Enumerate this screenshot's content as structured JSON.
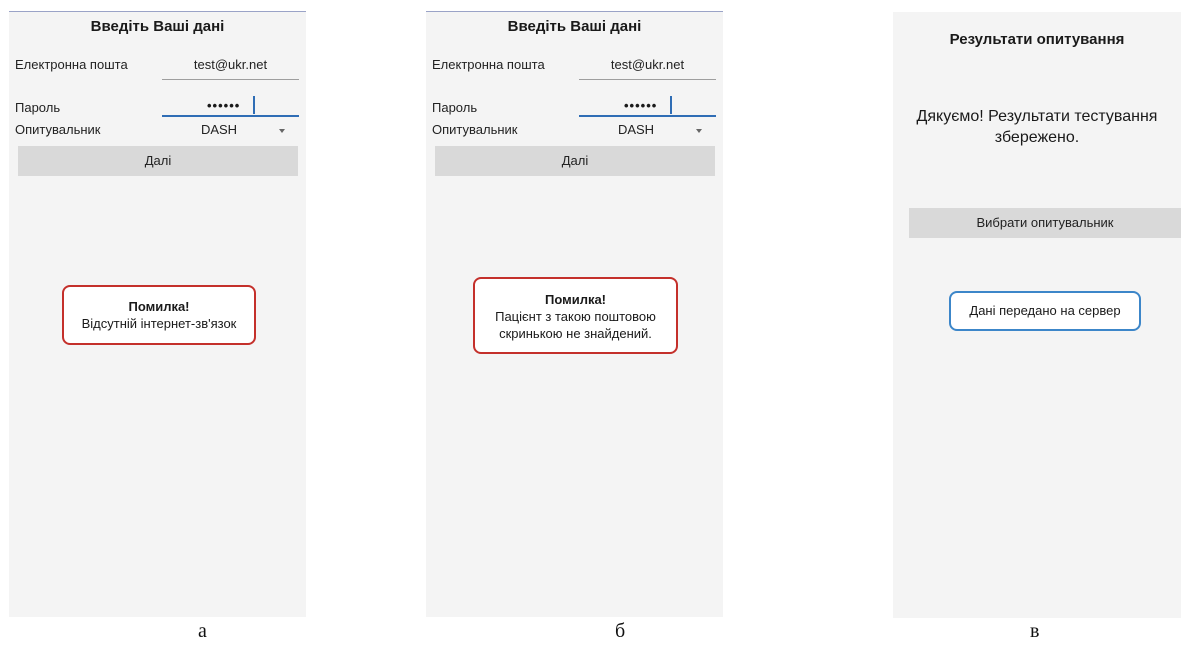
{
  "screens": {
    "a": {
      "title": "Введіть Ваші дані",
      "email_label": "Електронна пошта",
      "email_value": "test@ukr.net",
      "password_label": "Пароль",
      "password_value": "••••••",
      "survey_label": "Опитувальник",
      "survey_value": "DASH",
      "next_button": "Далі",
      "toast_title": "Помилка!",
      "toast_message": "Відсутній інтернет-зв'язок",
      "caption": "а"
    },
    "b": {
      "title": "Введіть Ваші дані",
      "email_label": "Електронна пошта",
      "email_value": "test@ukr.net",
      "password_label": "Пароль",
      "password_value": "••••••",
      "survey_label": "Опитувальник",
      "survey_value": "DASH",
      "next_button": "Далі",
      "toast_title": "Помилка!",
      "toast_message": "Пацієнт з такою поштовою\nскринькою не знайдений.",
      "caption": "б"
    },
    "c": {
      "title": "Результати опитування",
      "thanks_message": "Дякуємо! Результати тестування\nзбережено.",
      "choose_button": "Вибрати опитувальник",
      "toast_message": "Дані передано на сервер",
      "caption": "в"
    }
  },
  "colors": {
    "error_border": "#c4302b",
    "success_border": "#3c86c9",
    "focus_accent": "#2f6db5",
    "button_bg": "#d9d9d9",
    "screen_bg": "#f4f4f4"
  }
}
